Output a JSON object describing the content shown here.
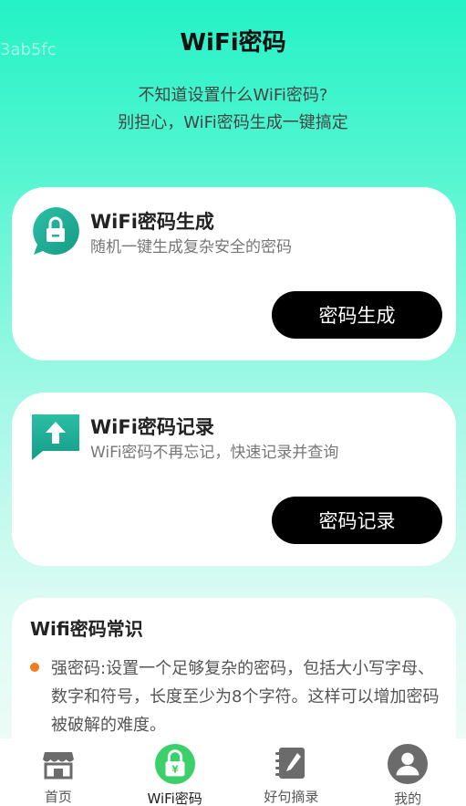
{
  "watermark": "3ab5fc",
  "header": {
    "title": "WiFi密码",
    "subtitle_line1": "不知道设置什么WiFi密码?",
    "subtitle_line2": "别担心，WiFi密码生成一键搞定"
  },
  "cards": [
    {
      "title": "WiFi密码生成",
      "desc": "随机一键生成复杂安全的密码",
      "button": "密码生成",
      "icon": "lock-chat-icon"
    },
    {
      "title": "WiFi密码记录",
      "desc": "WiFi密码不再忘记，快速记录并查询",
      "button": "密码记录",
      "icon": "upload-arrow-icon"
    }
  ],
  "tips": {
    "title": "Wifi密码常识",
    "items": [
      "强密码:设置一个足够复杂的密码，包括大小写字母、数字和符号，长度至少为8个字符。这样可以增加密码被破解的难度。"
    ]
  },
  "tabbar": {
    "active_index": 1,
    "tabs": [
      {
        "label": "首页",
        "icon": "shop-icon"
      },
      {
        "label": "WiFi密码",
        "icon": "lock-yen-icon"
      },
      {
        "label": "好句摘录",
        "icon": "notebook-pen-icon"
      },
      {
        "label": "我的",
        "icon": "user-icon"
      }
    ]
  },
  "colors": {
    "accent_green": "#3ccf6a",
    "teal_icon": "#1fb39a",
    "bullet_orange": "#f07c1a",
    "button_bg": "#000000"
  }
}
